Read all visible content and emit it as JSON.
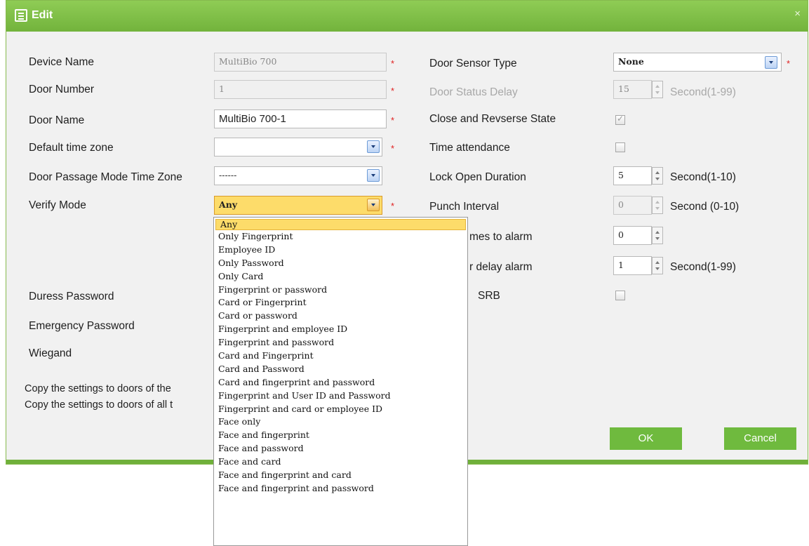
{
  "dialog": {
    "title": "Edit",
    "close_glyph": "×"
  },
  "form_left": {
    "device_name": {
      "label": "Device Name",
      "value": "MultiBio 700",
      "required": "*"
    },
    "door_number": {
      "label": "Door Number",
      "value": "1",
      "required": "*"
    },
    "door_name": {
      "label": "Door Name",
      "value": "MultiBio 700-1",
      "required": "*"
    },
    "default_time_zone": {
      "label": "Default time zone",
      "value": "",
      "required": "*"
    },
    "passage_mode": {
      "label": "Door Passage Mode Time Zone",
      "value": "------"
    },
    "verify_mode": {
      "label": "Verify Mode",
      "value": "Any",
      "required": "*"
    },
    "duress_password": {
      "label": "Duress Password"
    },
    "emergency_password": {
      "label": "Emergency Password"
    },
    "wiegand": {
      "label": "Wiegand"
    },
    "copy_same_device": "Copy the settings to doors of the",
    "copy_all": "Copy the settings to doors of all t"
  },
  "form_right": {
    "door_sensor_type": {
      "label": "Door Sensor Type",
      "value": "None",
      "required": "*"
    },
    "door_status_delay": {
      "label": "Door Status Delay",
      "value": "15",
      "unit": "Second(1-99)"
    },
    "close_reverse": {
      "label": "Close and Revserse State"
    },
    "time_attendance": {
      "label": "Time attendance"
    },
    "lock_open_duration": {
      "label": "Lock Open Duration",
      "value": "5",
      "unit": "Second(1-10)"
    },
    "punch_interval": {
      "label": "Punch Interval",
      "value": "0",
      "unit": "Second (0-10)"
    },
    "times_to_alarm": {
      "label": "mes to alarm",
      "value": "0"
    },
    "delay_alarm": {
      "label": "r delay alarm",
      "value": "1",
      "unit": "Second(1-99)"
    },
    "srb": {
      "label": "SRB"
    }
  },
  "buttons": {
    "ok": "OK",
    "cancel": "Cancel"
  },
  "verify_options": [
    "Any",
    "Only Fingerprint",
    "Employee ID",
    "Only Password",
    "Only Card",
    "Fingerprint or password",
    "Card or Fingerprint",
    "Card or password",
    "Fingerprint and employee ID",
    "Fingerprint and password",
    "Card and Fingerprint",
    "Card and Password",
    "Card and fingerprint and password",
    "Fingerprint and User ID and Password",
    "Fingerprint and card or employee ID",
    "Face only",
    "Face and fingerprint",
    "Face and password",
    "Face and card",
    "Face and fingerprint and card",
    "Face and fingerprint and password"
  ]
}
